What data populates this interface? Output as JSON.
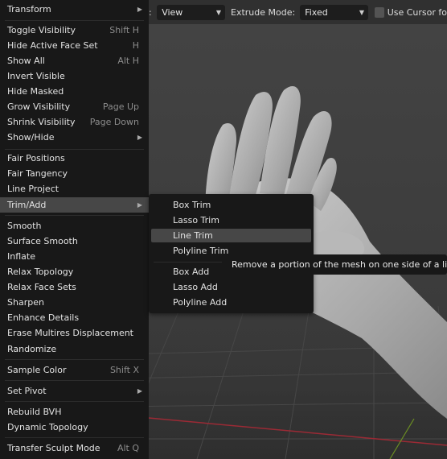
{
  "header": {
    "prefix": ":",
    "view_dropdown": "View",
    "extrude_label": "Extrude Mode:",
    "extrude_value": "Fixed",
    "use_cursor_label": "Use Cursor fo"
  },
  "menu": {
    "items": [
      {
        "label": "Transform",
        "shortcut": "",
        "submenu": true
      },
      {
        "label": "Toggle Visibility",
        "shortcut": "Shift H"
      },
      {
        "label": "Hide Active Face Set",
        "shortcut": "H"
      },
      {
        "label": "Show All",
        "shortcut": "Alt H"
      },
      {
        "label": "Invert Visible",
        "shortcut": ""
      },
      {
        "label": "Hide Masked",
        "shortcut": ""
      },
      {
        "label": "Grow Visibility",
        "shortcut": "Page Up"
      },
      {
        "label": "Shrink Visibility",
        "shortcut": "Page Down"
      },
      {
        "label": "Show/Hide",
        "shortcut": "",
        "submenu": true
      },
      {
        "label": "Fair Positions",
        "shortcut": ""
      },
      {
        "label": "Fair Tangency",
        "shortcut": ""
      },
      {
        "label": "Line Project",
        "shortcut": ""
      },
      {
        "label": "Trim/Add",
        "shortcut": "",
        "submenu": true
      },
      {
        "label": "Smooth",
        "shortcut": ""
      },
      {
        "label": "Surface Smooth",
        "shortcut": ""
      },
      {
        "label": "Inflate",
        "shortcut": ""
      },
      {
        "label": "Relax Topology",
        "shortcut": ""
      },
      {
        "label": "Relax Face Sets",
        "shortcut": ""
      },
      {
        "label": "Sharpen",
        "shortcut": ""
      },
      {
        "label": "Enhance Details",
        "shortcut": ""
      },
      {
        "label": "Erase Multires Displacement",
        "shortcut": ""
      },
      {
        "label": "Randomize",
        "shortcut": ""
      },
      {
        "label": "Sample Color",
        "shortcut": "Shift X"
      },
      {
        "label": "Set Pivot",
        "shortcut": "",
        "submenu": true
      },
      {
        "label": "Rebuild BVH",
        "shortcut": ""
      },
      {
        "label": "Dynamic Topology",
        "shortcut": ""
      },
      {
        "label": "Transfer Sculpt Mode",
        "shortcut": "Alt Q"
      }
    ]
  },
  "submenu": {
    "items": [
      {
        "label": "Box Trim"
      },
      {
        "label": "Lasso Trim"
      },
      {
        "label": "Line Trim"
      },
      {
        "label": "Polyline Trim"
      },
      {
        "label": "Box Add"
      },
      {
        "label": "Lasso Add"
      },
      {
        "label": "Polyline Add"
      }
    ]
  },
  "tooltip": {
    "text": "Remove a portion of the mesh on one side of a line."
  },
  "colors": {
    "menu_bg": "#181818",
    "active_bg": "#474747",
    "viewport_bg": "#3d3d3d",
    "grid_red": "#9b2a35"
  }
}
